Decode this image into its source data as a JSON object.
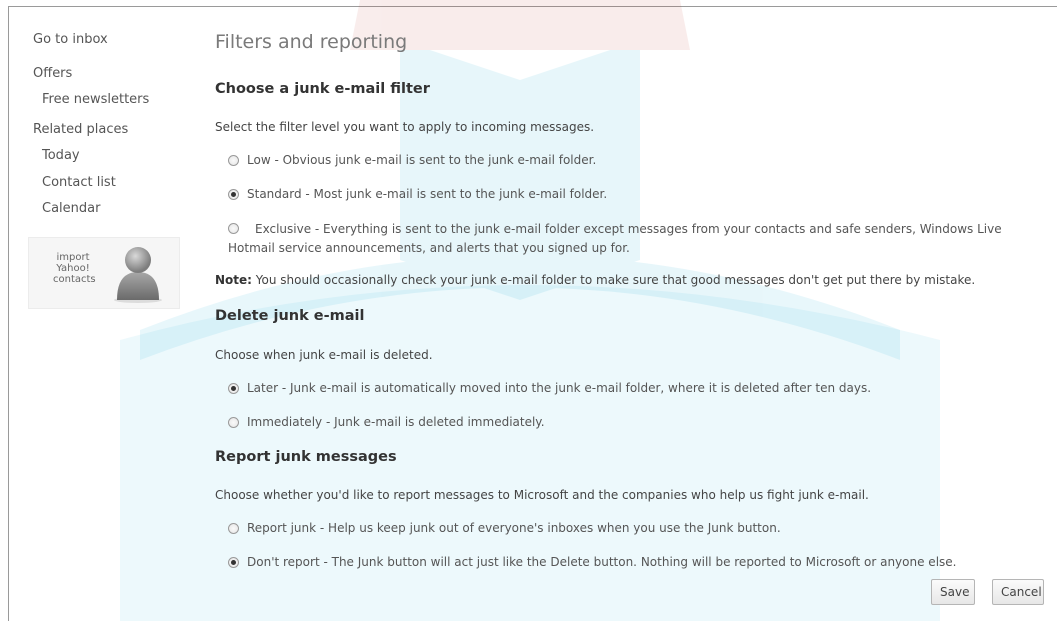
{
  "sidebar": {
    "go_to_inbox": "Go to inbox",
    "offers": "Offers",
    "free_newsletters": "Free newsletters",
    "related_places": "Related places",
    "today": "Today",
    "contact_list": "Contact list",
    "calendar": "Calendar",
    "import_line1": "import",
    "import_line2": "Yahoo!",
    "import_line3": "contacts"
  },
  "main": {
    "title": "Filters and reporting",
    "filter": {
      "heading": "Choose a junk e-mail filter",
      "description": "Select the filter level you want to apply to incoming messages.",
      "options": [
        {
          "label": "Low - Obvious junk e-mail is sent to the junk e-mail folder.",
          "selected": false
        },
        {
          "label": "Standard - Most junk e-mail is sent to the junk e-mail folder.",
          "selected": true
        },
        {
          "label": "Exclusive - Everything is sent to the junk e-mail folder except messages from your contacts and safe senders, Windows Live Hotmail service announcements, and alerts that you signed up for.",
          "selected": false
        }
      ],
      "note_label": "Note:",
      "note_text": " You should occasionally check your junk e-mail folder to make sure that good messages don't get put there by mistake."
    },
    "delete": {
      "heading": "Delete junk e-mail",
      "description": "Choose when junk e-mail is deleted.",
      "options": [
        {
          "label": "Later - Junk e-mail is automatically moved into the junk e-mail folder, where it is deleted after ten days.",
          "selected": true
        },
        {
          "label": "Immediately - Junk e-mail is deleted immediately.",
          "selected": false
        }
      ]
    },
    "report": {
      "heading": "Report junk messages",
      "description": "Choose whether you'd like to report messages to Microsoft and the companies who help us fight junk e-mail.",
      "options": [
        {
          "label": "Report junk - Help us keep junk out of everyone's inboxes when you use the Junk button.",
          "selected": false
        },
        {
          "label": "Don't report - The Junk button will act just like the Delete button. Nothing will be reported to Microsoft or anyone else.",
          "selected": true
        }
      ]
    },
    "buttons": {
      "save": "Save",
      "cancel": "Cancel"
    }
  },
  "colors": {
    "watermark": "#00a8d4",
    "watermark_accent": "#c0392b"
  }
}
